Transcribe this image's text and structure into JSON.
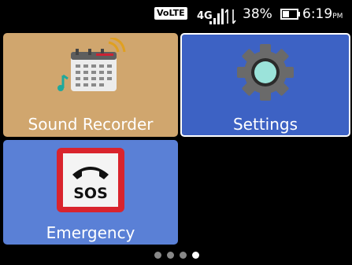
{
  "status_bar": {
    "volte": "VoLTE",
    "network": "4G",
    "battery_percent": "38%",
    "time": "6:19",
    "ampm": "PM"
  },
  "apps": [
    {
      "label": "Sound Recorder",
      "icon": "sound-recorder-icon",
      "color": "#d0a66e"
    },
    {
      "label": "Settings",
      "icon": "gear-icon",
      "color": "#3d62c4",
      "selected": true
    },
    {
      "label": "Emergency",
      "icon": "sos-phone-icon",
      "color": "#5a80d6",
      "icon_text": "SOS"
    }
  ],
  "pagination": {
    "pages": 4,
    "current": 4
  }
}
